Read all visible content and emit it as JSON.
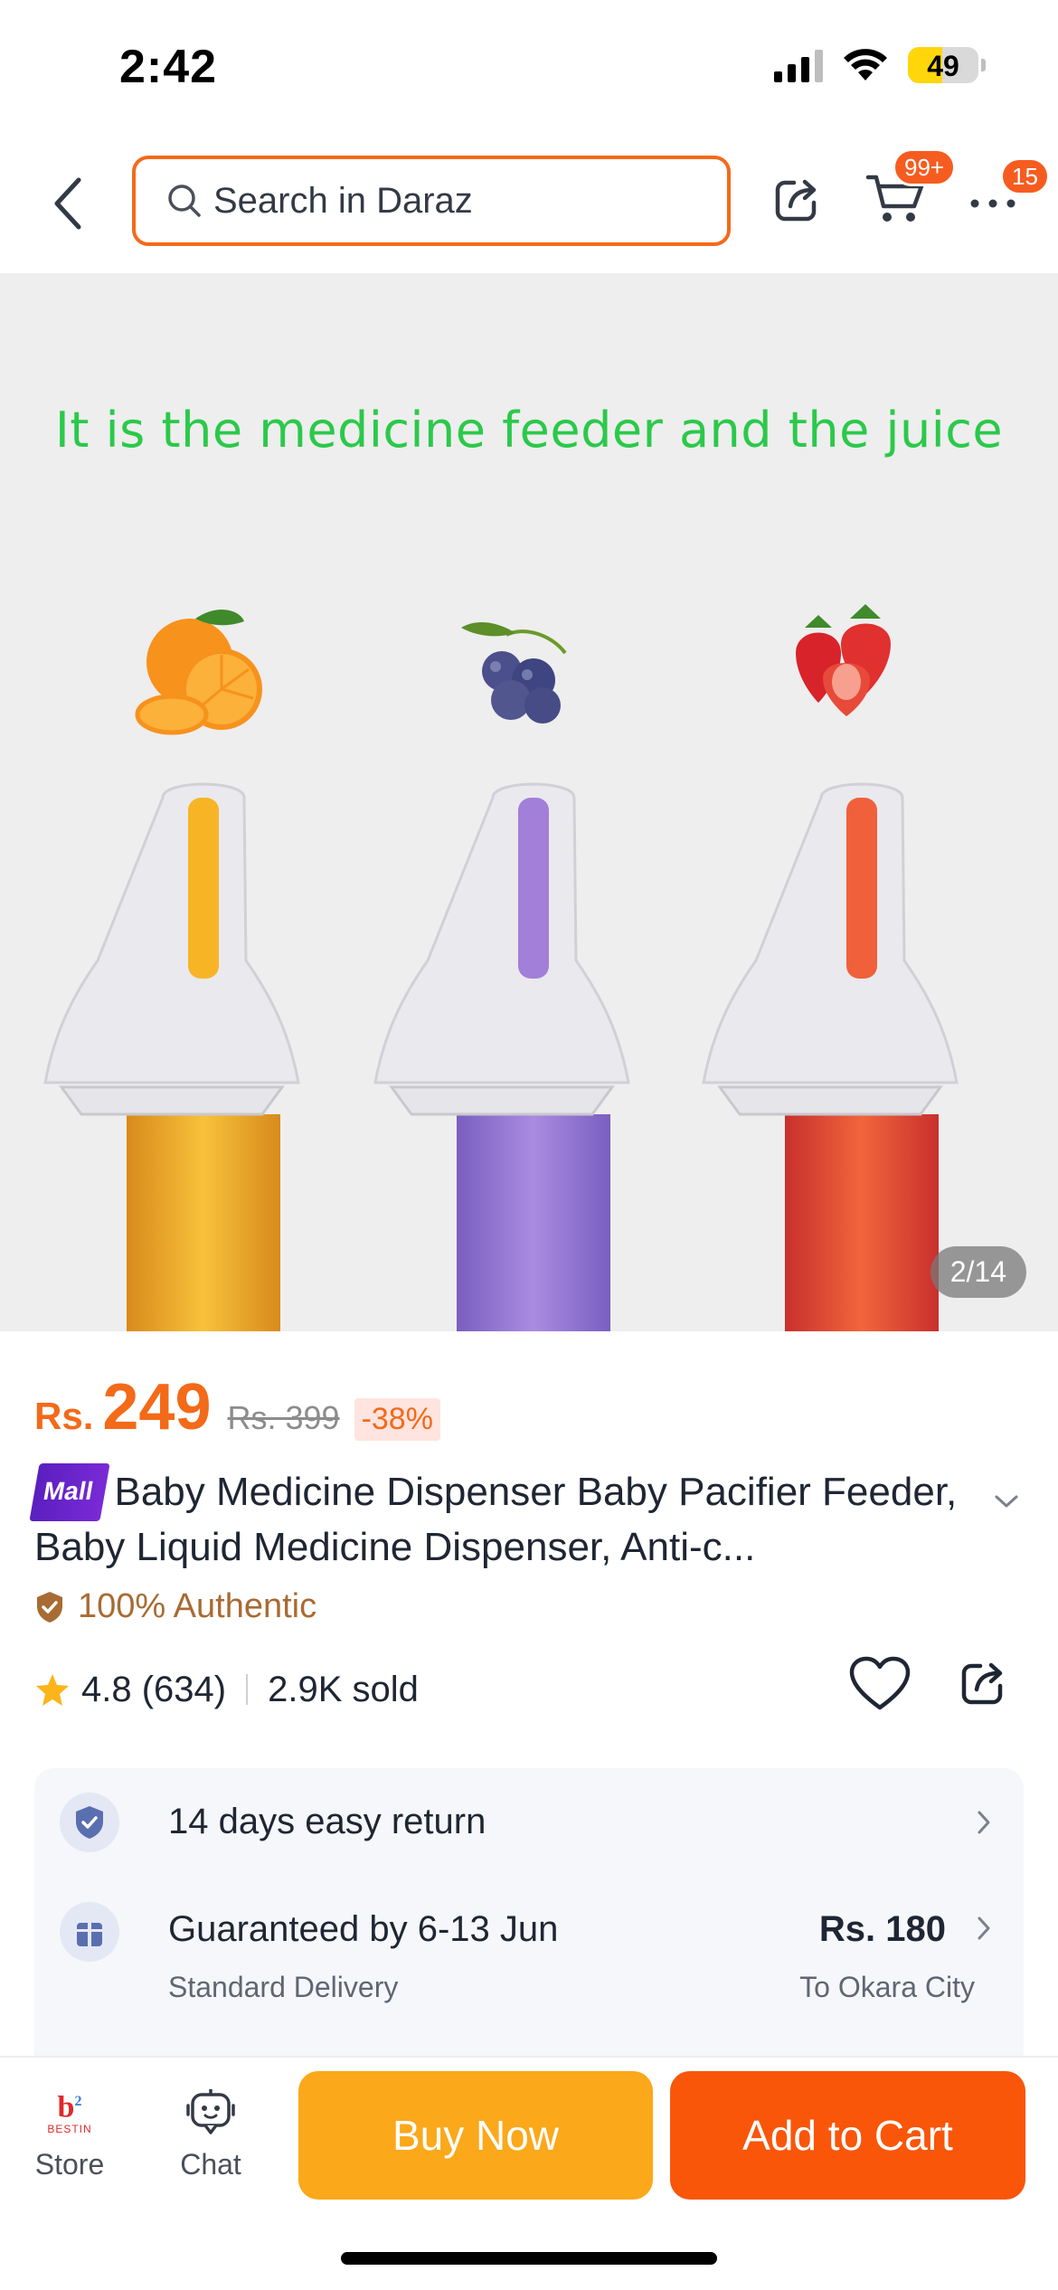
{
  "status_bar": {
    "time": "2:42",
    "battery_level": "49",
    "battery_fraction": 0.49
  },
  "nav": {
    "search_placeholder": "Search in Daraz",
    "cart_badge": "99+",
    "more_badge": "15"
  },
  "gallery": {
    "caption": "It is the medicine feeder and the juice",
    "page_indicator": "2/14",
    "fruits": [
      "orange",
      "grape",
      "strawberry"
    ]
  },
  "price": {
    "currency": "Rs.",
    "current": "249",
    "original": "Rs. 399",
    "discount": "-38%"
  },
  "product": {
    "mall_badge": "Mall",
    "title": "Baby Medicine Dispenser Baby Pacifier Feeder, Baby Liquid Medicine Dispenser, Anti-c...",
    "authentic": "100% Authentic",
    "rating": "4.8 (634)",
    "sold": "2.9K sold"
  },
  "services": {
    "return_text": "14 days easy return",
    "delivery_title": "Guaranteed by 6-13 Jun",
    "delivery_type": "Standard Delivery",
    "delivery_price": "Rs. 180",
    "delivery_location": "To Okara City"
  },
  "bottom_bar": {
    "store_label": "Store",
    "store_logo_text": "BESTIN",
    "chat_label": "Chat",
    "buy_now": "Buy Now",
    "add_to_cart": "Add to Cart"
  },
  "colors": {
    "accent": "#f36a19",
    "buy_now": "#fba81a",
    "add_to_cart": "#f9560a",
    "caption_green": "#2bc94a",
    "mall_purple": "#5a1fbf",
    "authentic_brown": "#a86b33"
  },
  "icons": [
    "back-arrow-icon",
    "search-icon",
    "share-icon",
    "cart-icon",
    "more-icon",
    "star-icon",
    "heart-icon",
    "shield-check-icon",
    "gift-box-icon",
    "chevron-right-icon",
    "chevron-down-icon",
    "chat-bot-icon",
    "store-logo-icon"
  ]
}
